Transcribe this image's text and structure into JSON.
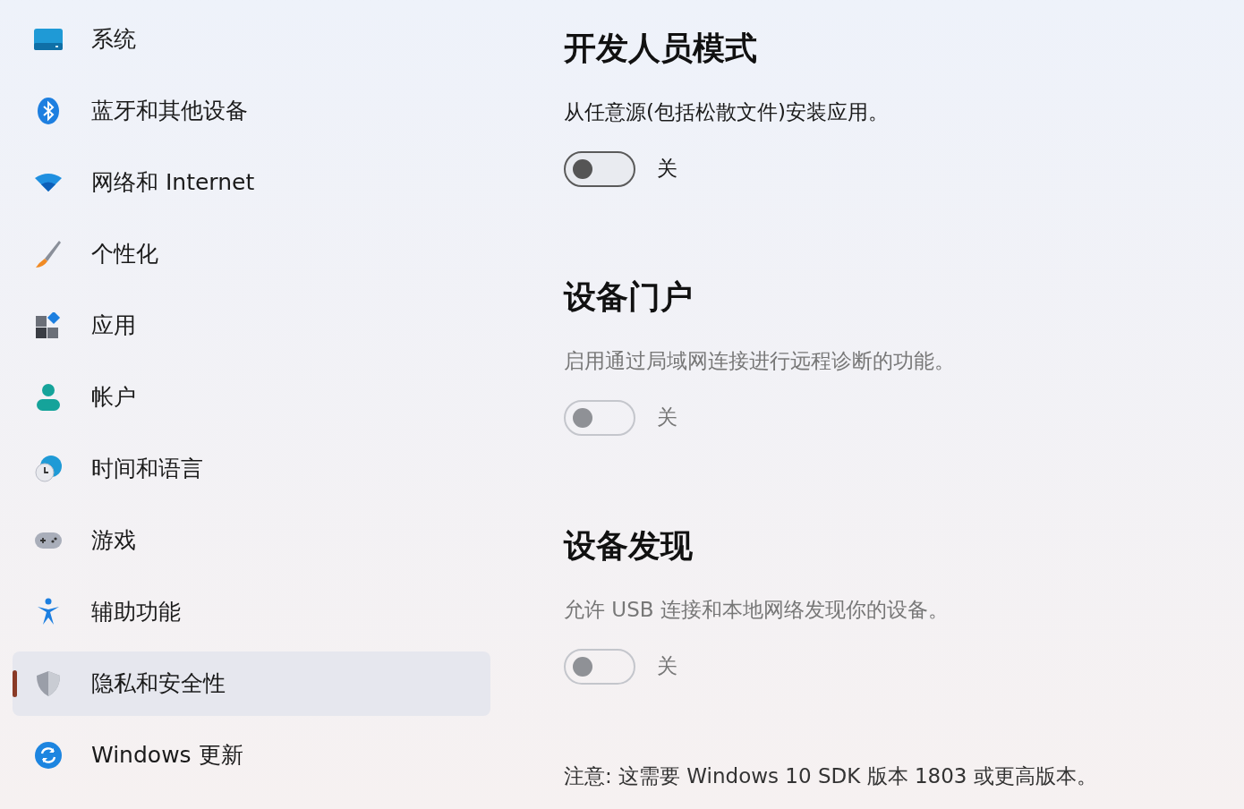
{
  "sidebar": {
    "items": [
      {
        "kind": "system",
        "label": "系统",
        "selected": false
      },
      {
        "kind": "bluetooth",
        "label": "蓝牙和其他设备",
        "selected": false
      },
      {
        "kind": "network",
        "label": "网络和 Internet",
        "selected": false
      },
      {
        "kind": "brush",
        "label": "个性化",
        "selected": false
      },
      {
        "kind": "apps",
        "label": "应用",
        "selected": false
      },
      {
        "kind": "account",
        "label": "帐户",
        "selected": false
      },
      {
        "kind": "time",
        "label": "时间和语言",
        "selected": false
      },
      {
        "kind": "gaming",
        "label": "游戏",
        "selected": false
      },
      {
        "kind": "accessibility",
        "label": "辅助功能",
        "selected": false
      },
      {
        "kind": "privacy",
        "label": "隐私和安全性",
        "selected": true
      },
      {
        "kind": "update",
        "label": "Windows 更新",
        "selected": false
      }
    ]
  },
  "sections": [
    {
      "title": "开发人员模式",
      "description": "从任意源(包括松散文件)安装应用。",
      "toggle": {
        "on": false,
        "disabled": false,
        "state_label": "关"
      }
    },
    {
      "title": "设备门户",
      "description": "启用通过局域网连接进行远程诊断的功能。",
      "toggle": {
        "on": false,
        "disabled": true,
        "state_label": "关"
      }
    },
    {
      "title": "设备发现",
      "description": "允许 USB 连接和本地网络发现你的设备。",
      "toggle": {
        "on": false,
        "disabled": true,
        "state_label": "关"
      }
    }
  ],
  "note": "注意: 这需要 Windows 10 SDK 版本 1803 或更高版本。"
}
